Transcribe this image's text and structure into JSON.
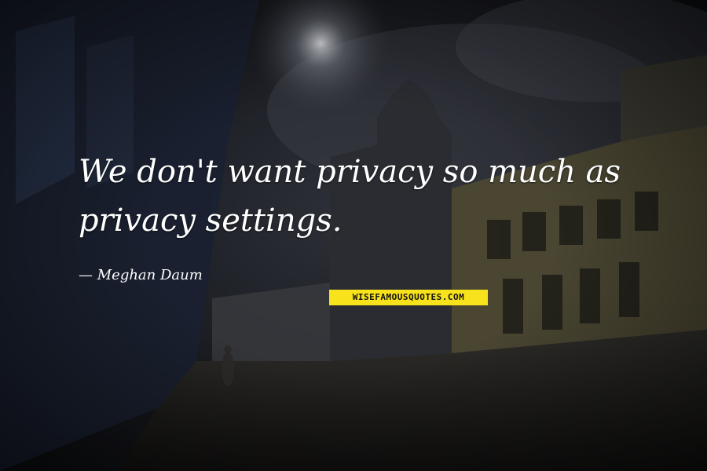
{
  "quote": {
    "line1": "We don't want privacy so much as",
    "line2": "privacy settings.",
    "author": "Meghan Daum"
  },
  "watermark": "WISEFAMOUSQUOTES.COM",
  "colors": {
    "text": "#ffffff",
    "watermark_bg": "#f7e21b"
  }
}
